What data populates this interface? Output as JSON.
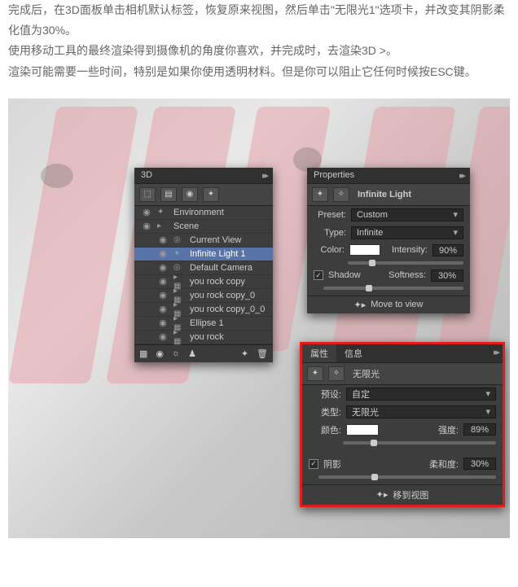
{
  "article": {
    "p1": "完成后，在3D面板单击相机默认标签，恢复原来视图，然后单击\"无限光1\"选项卡，并改变其阴影柔化值为30%。",
    "p2": "使用移动工具的最终渲染得到摄像机的角度你喜欢，并完成时，去渲染3D >。",
    "p3": "渲染可能需要一些时间，特别是如果你使用透明材料。但是你可以阻止它任何时候按ESC键。"
  },
  "panel3d": {
    "title": "3D",
    "items": {
      "env": "Environment",
      "scene": "Scene",
      "currentView": "Current View",
      "infiniteLight1": "Infinite Light 1",
      "defaultCamera": "Default Camera",
      "youRockCopy": "you rock copy",
      "youRockCopy0": "you rock copy_0",
      "youRockCopy00": "you rock copy_0_0",
      "ellipse1": "Ellipse 1",
      "youRock": "you rock"
    }
  },
  "propertiesEn": {
    "title": "Properties",
    "heading": "Infinite Light",
    "presetLabel": "Preset:",
    "presetValue": "Custom",
    "typeLabel": "Type:",
    "typeValue": "Infinite",
    "colorLabel": "Color:",
    "intensityLabel": "Intensity:",
    "intensityValue": "90%",
    "shadowLabel": "Shadow",
    "softnessLabel": "Softness:",
    "softnessValue": "30%",
    "moveToView": "Move to view"
  },
  "propertiesCn": {
    "tab1": "属性",
    "tab2": "信息",
    "heading": "无限光",
    "presetLabel": "预设:",
    "presetValue": "自定",
    "typeLabel": "类型:",
    "typeValue": "无限光",
    "colorLabel": "颜色:",
    "intensityLabel": "强度:",
    "intensityValue": "89%",
    "shadowLabel": "阴影",
    "softnessLabel": "柔和度:",
    "softnessValue": "30%",
    "moveToView": "移到视图"
  }
}
